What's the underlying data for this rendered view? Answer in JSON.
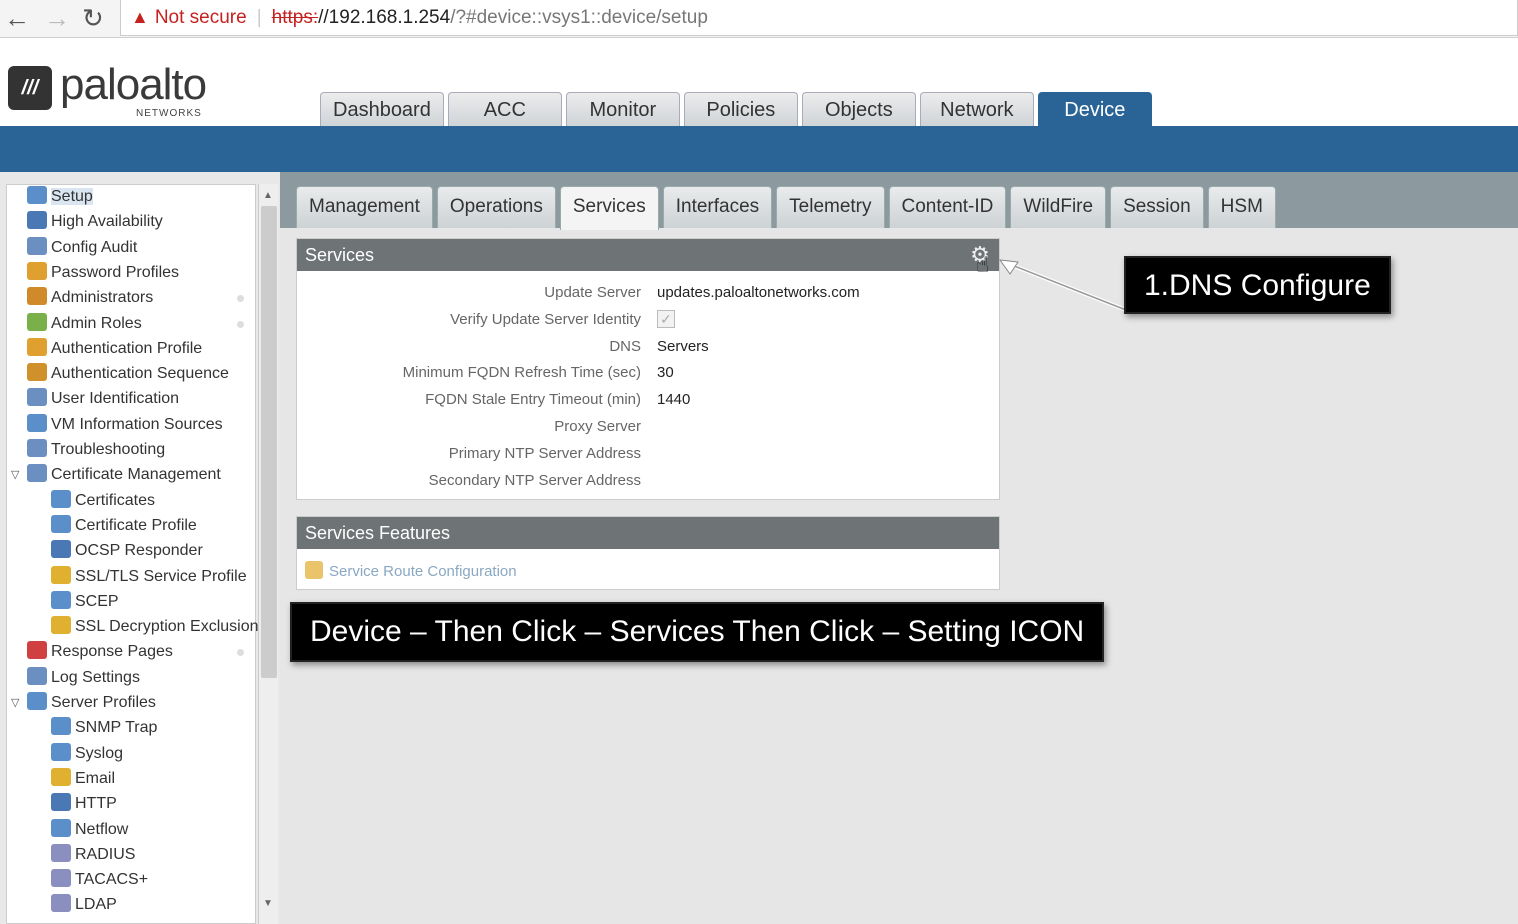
{
  "browser": {
    "security_label": "Not secure",
    "url_scheme": "https:",
    "url_host": "//192.168.1.254",
    "url_path": "/?#device::vsys1::device/setup"
  },
  "logo": {
    "name": "paloalto",
    "sub": "NETWORKS"
  },
  "main_tabs": [
    "Dashboard",
    "ACC",
    "Monitor",
    "Policies",
    "Objects",
    "Network",
    "Device"
  ],
  "active_main_tab": "Device",
  "sub_tabs": [
    "Management",
    "Operations",
    "Services",
    "Interfaces",
    "Telemetry",
    "Content-ID",
    "WildFire",
    "Session",
    "HSM"
  ],
  "active_sub_tab": "Services",
  "tree": [
    {
      "label": "Setup"
    },
    {
      "label": "High Availability"
    },
    {
      "label": "Config Audit"
    },
    {
      "label": "Password Profiles"
    },
    {
      "label": "Administrators"
    },
    {
      "label": "Admin Roles"
    },
    {
      "label": "Authentication Profile"
    },
    {
      "label": "Authentication Sequence"
    },
    {
      "label": "User Identification"
    },
    {
      "label": "VM Information Sources"
    },
    {
      "label": "Troubleshooting"
    },
    {
      "label": "Certificate Management"
    },
    {
      "label": "Certificates"
    },
    {
      "label": "Certificate Profile"
    },
    {
      "label": "OCSP Responder"
    },
    {
      "label": "SSL/TLS Service Profile"
    },
    {
      "label": "SCEP"
    },
    {
      "label": "SSL Decryption Exclusion"
    },
    {
      "label": "Response Pages"
    },
    {
      "label": "Log Settings"
    },
    {
      "label": "Server Profiles"
    },
    {
      "label": "SNMP Trap"
    },
    {
      "label": "Syslog"
    },
    {
      "label": "Email"
    },
    {
      "label": "HTTP"
    },
    {
      "label": "Netflow"
    },
    {
      "label": "RADIUS"
    },
    {
      "label": "TACACS+"
    },
    {
      "label": "LDAP"
    }
  ],
  "services": {
    "title": "Services",
    "rows": [
      {
        "key": "Update Server",
        "value": "updates.paloaltonetworks.com"
      },
      {
        "key": "Verify Update Server Identity",
        "value": ""
      },
      {
        "key": "DNS",
        "value": "Servers"
      },
      {
        "key": "Minimum FQDN Refresh Time (sec)",
        "value": "30"
      },
      {
        "key": "FQDN Stale Entry Timeout (min)",
        "value": "1440"
      },
      {
        "key": "Proxy Server",
        "value": ""
      },
      {
        "key": "Primary NTP Server Address",
        "value": ""
      },
      {
        "key": "Secondary NTP Server Address",
        "value": ""
      }
    ]
  },
  "features": {
    "title": "Services Features",
    "link": "Service Route Configuration"
  },
  "callouts": {
    "dns": "1.DNS Configure",
    "instructions": "Device – Then Click – Services Then Click – Setting ICON"
  },
  "colors": {
    "brand_blue": "#2a6496",
    "header_gray": "#6e7375"
  }
}
